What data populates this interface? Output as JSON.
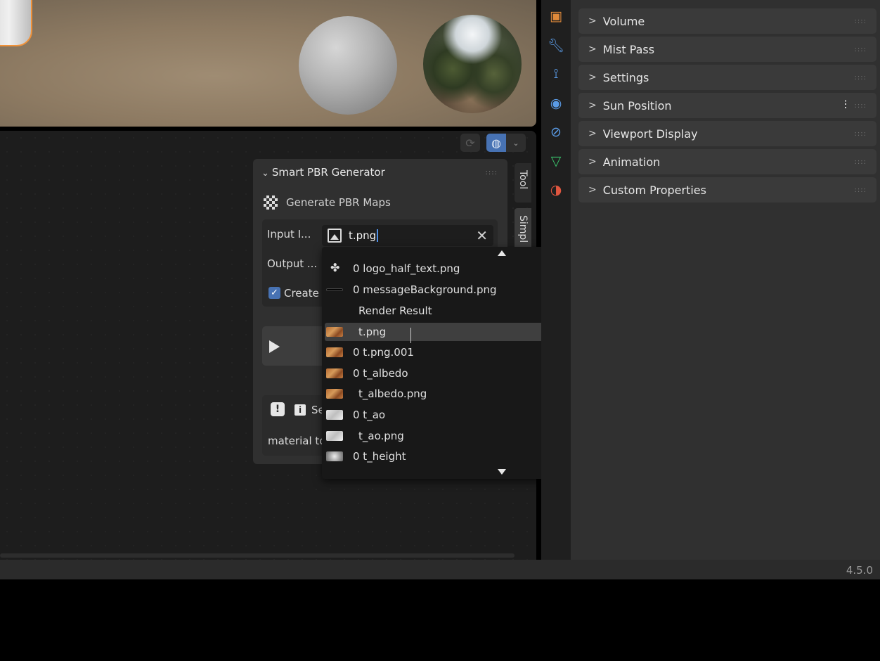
{
  "panel": {
    "title": "Smart PBR Generator",
    "generate_label": "Generate PBR Maps",
    "input_label": "Input I...",
    "input_value": "t.png",
    "output_label": "Output ...",
    "create_label": "Create",
    "info_label": "Se",
    "material_text": "material to"
  },
  "tabs": {
    "tool": "Tool",
    "simple": "Simpl"
  },
  "dropdown": {
    "items": [
      {
        "label": "0 logo_half_text.png",
        "thumb": "logo"
      },
      {
        "label": "0 messageBackground.png",
        "thumb": "black"
      },
      {
        "label": "Render Result",
        "thumb": "none"
      },
      {
        "label": "t.png",
        "thumb": "wood",
        "highlighted": true
      },
      {
        "label": "0 t.png.001",
        "thumb": "wood"
      },
      {
        "label": "0 t_albedo",
        "thumb": "wood"
      },
      {
        "label": "t_albedo.png",
        "thumb": "wood"
      },
      {
        "label": "0 t_ao",
        "thumb": "white"
      },
      {
        "label": "t_ao.png",
        "thumb": "white"
      },
      {
        "label": "0 t_height",
        "thumb": "gray-noise"
      }
    ]
  },
  "properties": {
    "sections": [
      {
        "label": "Volume"
      },
      {
        "label": "Mist Pass"
      },
      {
        "label": "Settings"
      },
      {
        "label": "Sun Position",
        "has_preset_icon": true
      },
      {
        "label": "Viewport Display"
      },
      {
        "label": "Animation"
      },
      {
        "label": "Custom Properties"
      }
    ]
  },
  "toolbar_icons": [
    "object-icon",
    "wrench-icon",
    "particles-icon",
    "physics-icon",
    "constraints-icon",
    "object-data-icon",
    "material-icon"
  ],
  "colors": {
    "accent": "#4772b3",
    "selection_outline": "#f0923a"
  },
  "status": {
    "version": "4.5.0"
  }
}
